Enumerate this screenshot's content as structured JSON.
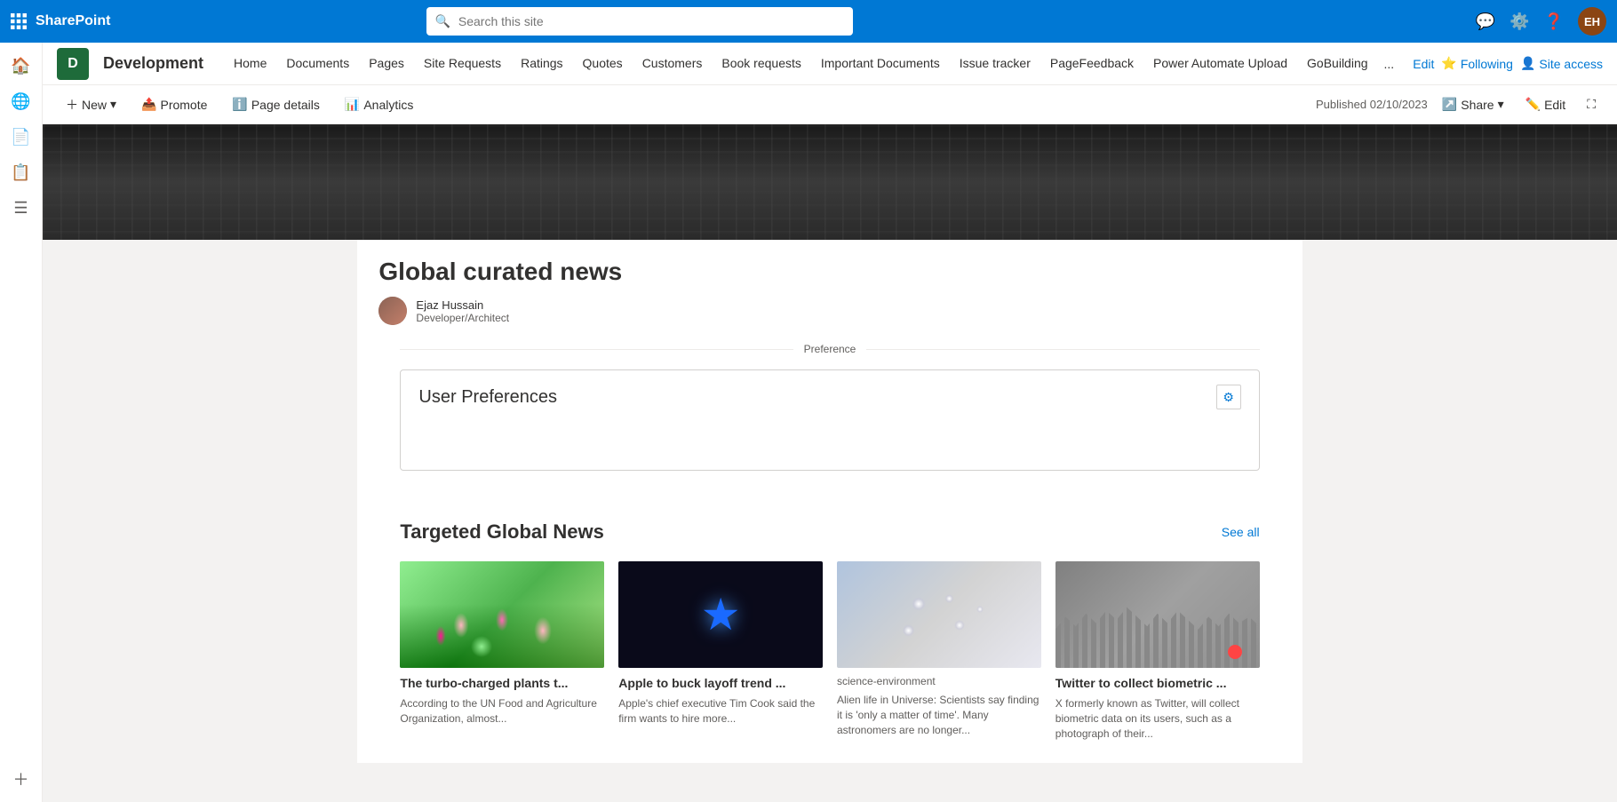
{
  "topbar": {
    "title": "SharePoint",
    "search_placeholder": "Search this site",
    "icons": [
      "chat-icon",
      "settings-icon",
      "help-icon"
    ],
    "avatar_initials": "EH"
  },
  "sidebar": {
    "icons": [
      "home-icon",
      "globe-icon",
      "documents-icon",
      "pages-icon",
      "lists-icon"
    ],
    "add_label": "+"
  },
  "site": {
    "logo_letter": "D",
    "name": "Development",
    "nav_items": [
      {
        "label": "Home"
      },
      {
        "label": "Documents"
      },
      {
        "label": "Pages"
      },
      {
        "label": "Site Requests"
      },
      {
        "label": "Ratings"
      },
      {
        "label": "Quotes"
      },
      {
        "label": "Customers"
      },
      {
        "label": "Book requests"
      },
      {
        "label": "Important Documents"
      },
      {
        "label": "Issue tracker"
      },
      {
        "label": "PageFeedback"
      },
      {
        "label": "Power Automate Upload"
      },
      {
        "label": "GoBuilding"
      }
    ],
    "more_label": "...",
    "edit_label": "Edit",
    "following_label": "Following",
    "site_access_label": "Site access"
  },
  "toolbar": {
    "new_label": "New",
    "promote_label": "Promote",
    "page_details_label": "Page details",
    "analytics_label": "Analytics",
    "published_text": "Published 02/10/2023",
    "share_label": "Share",
    "edit_label": "Edit",
    "expand_label": "Expand"
  },
  "page": {
    "title": "Global curated news",
    "author_name": "Ejaz Hussain",
    "author_role": "Developer/Architect",
    "preference_label": "Preference",
    "user_prefs_title": "User Preferences",
    "news_section_title": "Targeted Global News",
    "see_all_label": "See all",
    "news_cards": [
      {
        "image_type": "flowers",
        "category": "",
        "headline": "The turbo-charged plants t...",
        "excerpt": "According to the UN Food and Agriculture Organization, almost..."
      },
      {
        "image_type": "apple",
        "category": "",
        "headline": "Apple to buck layoff trend ...",
        "excerpt": "Apple's chief executive Tim Cook said the firm wants to hire more..."
      },
      {
        "image_type": "science",
        "category": "science-environment",
        "headline": "",
        "excerpt": "Alien life in Universe: Scientists say finding it is 'only a matter of time'. Many astronomers are no longer..."
      },
      {
        "image_type": "twitter",
        "category": "",
        "headline": "Twitter to collect biometric ...",
        "excerpt": "X formerly known as Twitter, will collect biometric data on its users, such as a photograph of their..."
      }
    ]
  }
}
